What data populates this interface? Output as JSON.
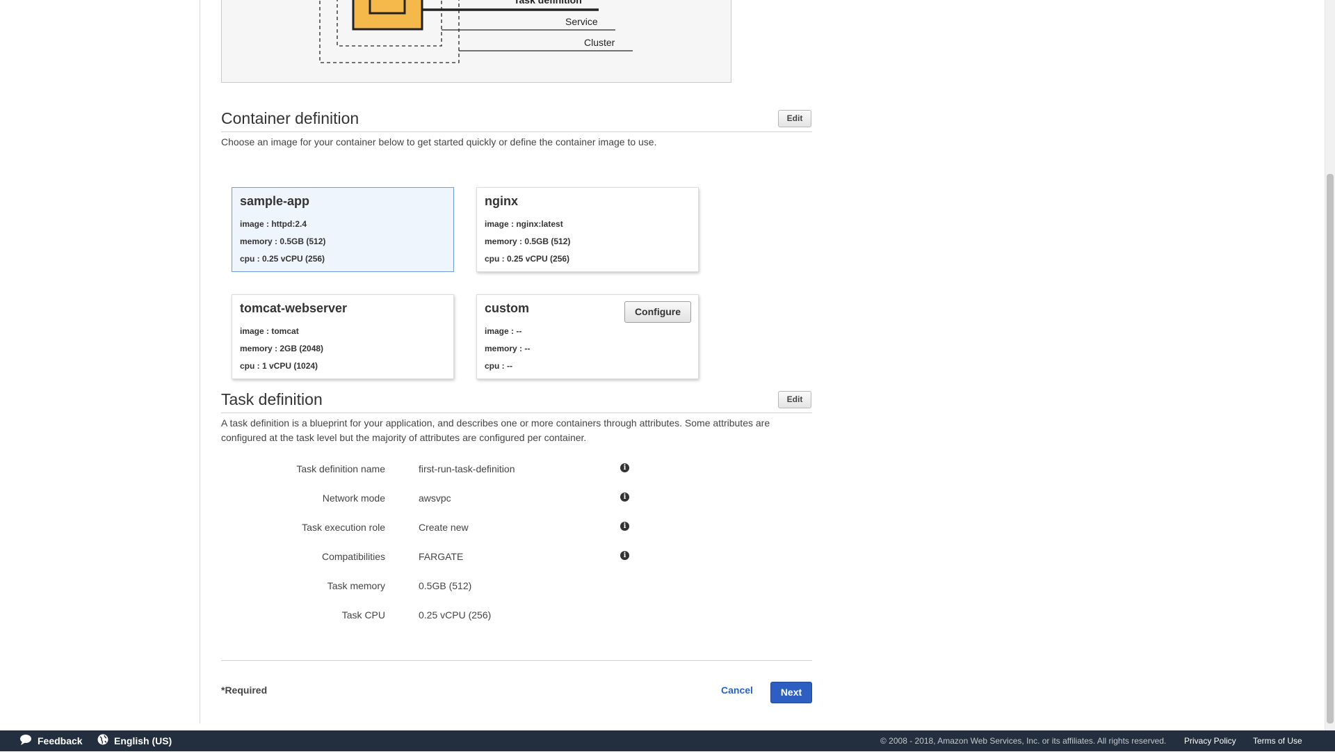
{
  "diagram": {
    "labels": {
      "task_definition": "Task definition",
      "service": "Service",
      "cluster": "Cluster"
    }
  },
  "container_definition": {
    "title": "Container definition",
    "edit_label": "Edit",
    "description": "Choose an image for your container below to get started quickly or define the container image to use.",
    "cards": [
      {
        "name": "sample-app",
        "image": "image : httpd:2.4",
        "memory": "memory :  0.5GB (512)",
        "cpu": "cpu :  0.25 vCPU (256)",
        "selected": true
      },
      {
        "name": "nginx",
        "image": "image : nginx:latest",
        "memory": "memory :  0.5GB (512)",
        "cpu": "cpu :  0.25 vCPU (256)",
        "selected": false
      },
      {
        "name": "tomcat-webserver",
        "image": "image : tomcat",
        "memory": "memory :  2GB (2048)",
        "cpu": "cpu :  1 vCPU (1024)",
        "selected": false
      },
      {
        "name": "custom",
        "image": "image : --",
        "memory": "memory :  --",
        "cpu": "cpu :  --",
        "selected": false,
        "configure_label": "Configure"
      }
    ]
  },
  "task_definition": {
    "title": "Task definition",
    "edit_label": "Edit",
    "description": "A task definition is a blueprint for your application, and describes one or more containers through attributes. Some attributes are configured at the task level but the majority of attributes are configured per container.",
    "fields": [
      {
        "label": "Task definition name",
        "value": "first-run-task-definition",
        "info_icon": true
      },
      {
        "label": "Network mode",
        "value": "awsvpc",
        "info_icon": true
      },
      {
        "label": "Task execution role",
        "value": "Create new",
        "info_icon": true
      },
      {
        "label": "Compatibilities",
        "value": "FARGATE",
        "info_icon": true
      },
      {
        "label": "Task memory",
        "value": "0.5GB (512)",
        "info_icon": false
      },
      {
        "label": "Task CPU",
        "value": "0.25 vCPU (256)",
        "info_icon": false
      }
    ],
    "info_icon_name": "info-icon"
  },
  "actions": {
    "required_label": "*Required",
    "cancel_label": "Cancel",
    "next_label": "Next"
  },
  "footer": {
    "feedback_label": "Feedback",
    "language_label": "English (US)",
    "copyright": "© 2008 - 2018, Amazon Web Services, Inc. or its affiliates. All rights reserved.",
    "privacy_label": "Privacy Policy",
    "terms_label": "Terms of Use"
  },
  "colors": {
    "footer_bg": "#232f3e",
    "primary_button": "#2d5ec2",
    "link": "#2a61c5",
    "selected_card_bg": "#eef5fc",
    "diagram_box": "#f5b94b"
  }
}
